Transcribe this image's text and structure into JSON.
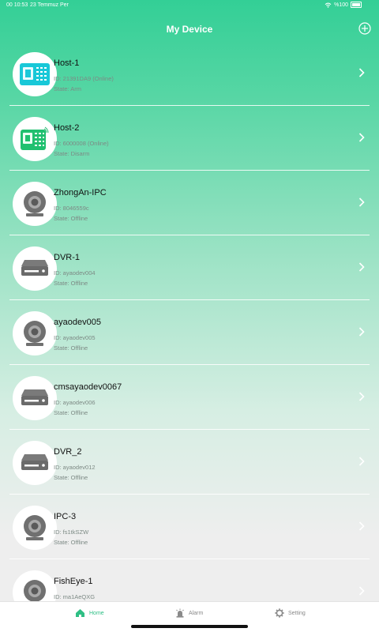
{
  "status_bar": {
    "time": "00 10:53",
    "date": "23 Temmuz Per",
    "battery": "%100"
  },
  "header": {
    "title": "My Device"
  },
  "devices": [
    {
      "name": "Host-1",
      "id": "ID: 21391DA9 (Online)",
      "state": "State: Arm",
      "icon": "alarm-host-cyan-icon"
    },
    {
      "name": "Host-2",
      "id": "ID: 6000008 (Online)",
      "state": "State: Disarm",
      "icon": "alarm-host-green-icon"
    },
    {
      "name": "ZhongAn-IPC",
      "id": "ID: 8046559c",
      "state": "State: Offline",
      "icon": "ip-camera-icon"
    },
    {
      "name": "DVR-1",
      "id": "ID: ayaodev004",
      "state": "State: Offline",
      "icon": "dvr-icon"
    },
    {
      "name": "ayaodev005",
      "id": "ID: ayaodev005",
      "state": "State: Offline",
      "icon": "ip-camera-icon"
    },
    {
      "name": "cmsayaodev0067",
      "id": "ID: ayaodev006",
      "state": "State: Offline",
      "icon": "dvr-icon"
    },
    {
      "name": "DVR_2",
      "id": "ID: ayaodev012",
      "state": "State: Offline",
      "icon": "dvr-icon"
    },
    {
      "name": "IPC-3",
      "id": "ID: fs1tkSZW",
      "state": "State: Offline",
      "icon": "ip-camera-icon"
    },
    {
      "name": "FishEye-1",
      "id": "ID: ma1AeQXG",
      "state": "",
      "icon": "ip-camera-icon"
    }
  ],
  "tabs": {
    "home": "Home",
    "alarm": "Alarm",
    "setting": "Setting"
  },
  "colors": {
    "accent": "#2fbf85",
    "header_top": "#33cf96"
  }
}
